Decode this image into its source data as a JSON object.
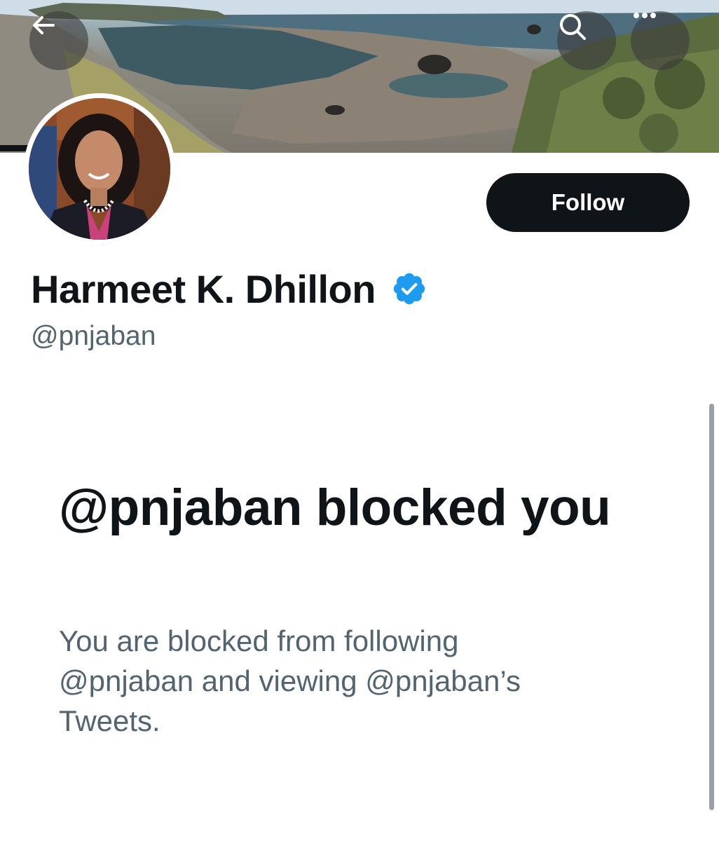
{
  "header": {
    "back_icon": "arrow-left-icon",
    "search_icon": "search-icon",
    "more_icon": "more-dots-icon"
  },
  "profile": {
    "display_name": "Harmeet K. Dhillon",
    "handle": "@pnjaban",
    "verified_icon": "verified-badge-icon",
    "verified_color": "#1d9bf0",
    "follow_label": "Follow"
  },
  "blocked": {
    "title": "@pnjaban blocked you",
    "body": "You are blocked from following @pnjaban and viewing @pnjaban’s Tweets."
  },
  "colors": {
    "text_primary": "#0f1419",
    "text_secondary": "#536471",
    "button_bg": "#0f1419",
    "button_text": "#ffffff"
  }
}
